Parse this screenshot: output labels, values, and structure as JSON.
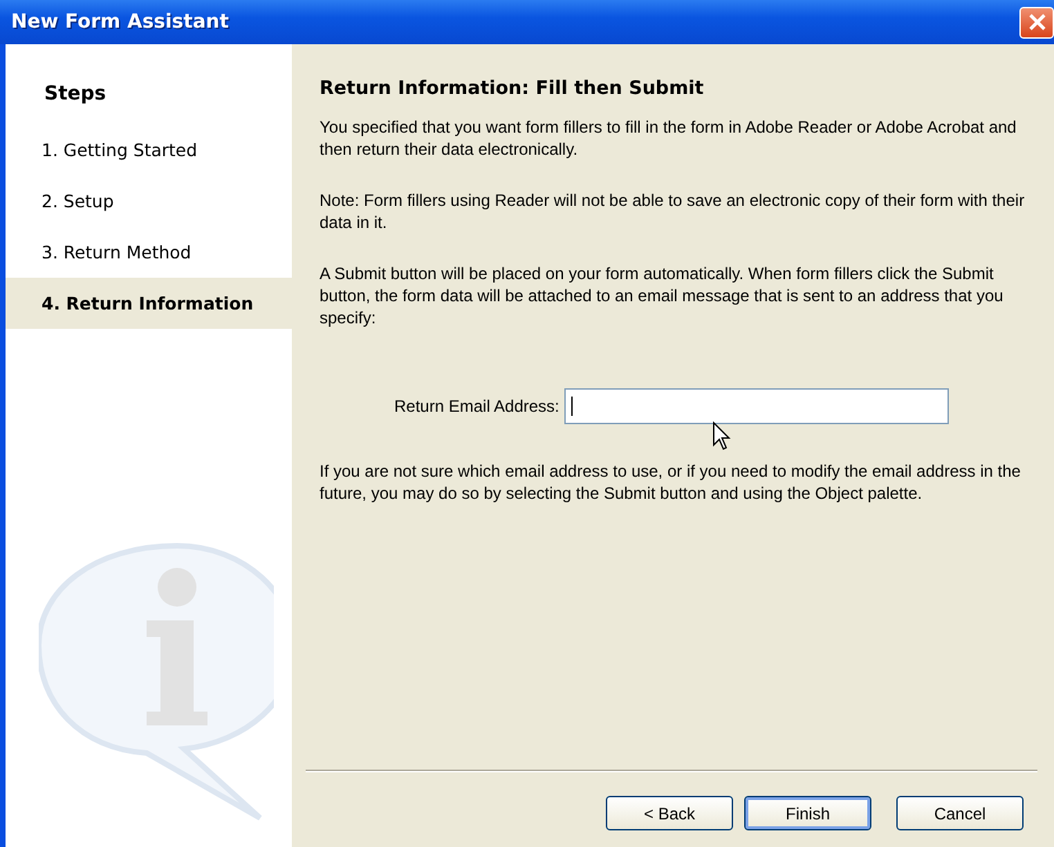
{
  "window": {
    "title": "New Form Assistant"
  },
  "sidebar": {
    "heading": "Steps",
    "items": [
      {
        "label": "1. Getting Started",
        "selected": false
      },
      {
        "label": "2. Setup",
        "selected": false
      },
      {
        "label": "3. Return Method",
        "selected": false
      },
      {
        "label": "4. Return Information",
        "selected": true
      }
    ]
  },
  "content": {
    "heading": "Return Information: Fill then Submit",
    "paragraphs": [
      "You specified that you want form fillers to fill in the form in Adobe Reader or Adobe Acrobat and then return their data electronically.",
      "Note: Form fillers using Reader will not be able to save an electronic copy of their form with their data in it.",
      "A Submit button will be placed on your form automatically.  When form fillers click the Submit button, the form data will be attached to an email message that is sent to an address that you specify:"
    ],
    "email_field": {
      "label": "Return Email Address:"
    },
    "footnote": "If you are not sure which email address to use, or if you need to modify the email address in the future, you may do so  by selecting the Submit button and using the Object palette."
  },
  "buttons": [
    {
      "label": "< Back",
      "kind": "normal"
    },
    {
      "label": "Finish",
      "kind": "default"
    },
    {
      "label": "Cancel",
      "kind": "normal"
    }
  ]
}
